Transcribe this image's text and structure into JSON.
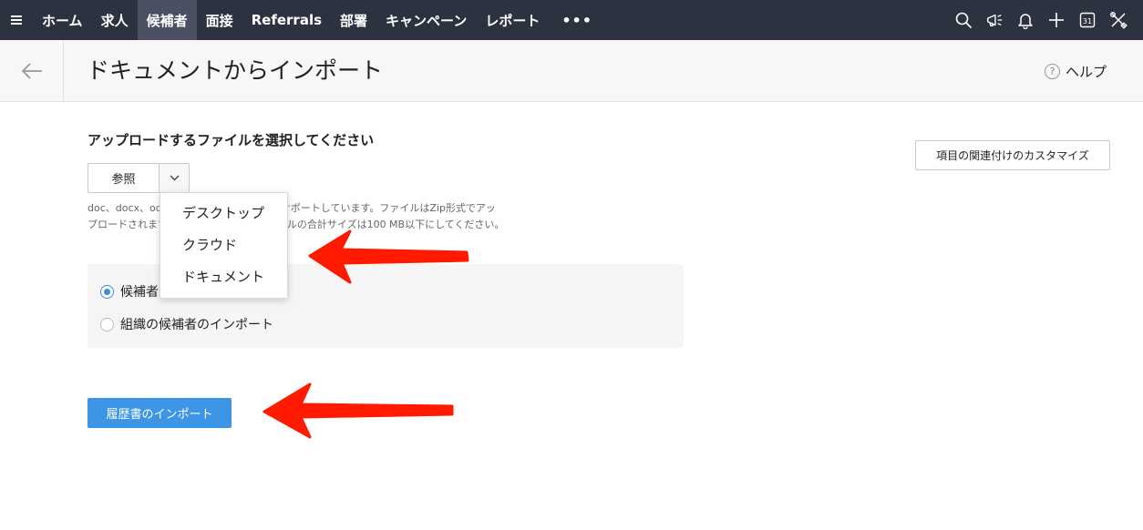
{
  "topnav": {
    "items": [
      {
        "label": "ホーム",
        "active": false
      },
      {
        "label": "求人",
        "active": false
      },
      {
        "label": "候補者",
        "active": true
      },
      {
        "label": "面接",
        "active": false
      },
      {
        "label": "Referrals",
        "active": false
      },
      {
        "label": "部署",
        "active": false
      },
      {
        "label": "キャンペーン",
        "active": false
      },
      {
        "label": "レポート",
        "active": false
      }
    ],
    "more_label": "•••",
    "icons": [
      "search-icon",
      "megaphone-icon",
      "bell-icon",
      "plus-icon",
      "calendar-icon",
      "tools-icon"
    ],
    "calendar_day": "31"
  },
  "header": {
    "title": "ドキュメントからインポート",
    "help_icon": "?",
    "help_label": "ヘルプ"
  },
  "upload": {
    "section_title": "アップロードするファイルを選択してください",
    "browse_label": "参照",
    "support_text_line1": "doc、docx、odt、rtf、txt、html、pdfをサポートしています。ファイルはZip形式でアッ",
    "support_text_line2": "プロードされます。アップロードするファイルの合計サイズは100 MB以下にしてください。"
  },
  "customize_button_label": "項目の関連付けのカスタマイズ",
  "dropdown": {
    "items": [
      "デスクトップ",
      "クラウド",
      "ドキュメント"
    ]
  },
  "options": {
    "radio1_label": "候補者のインポート",
    "radio1_checked": true,
    "radio2_label": "組織の候補者のインポート",
    "radio2_checked": false
  },
  "import_button_label": "履歴書のインポート",
  "colors": {
    "nav_bg": "#2c3240",
    "nav_active": "#4a5061",
    "primary": "#3d95e6",
    "annotation_arrow": "#ff1a00"
  }
}
